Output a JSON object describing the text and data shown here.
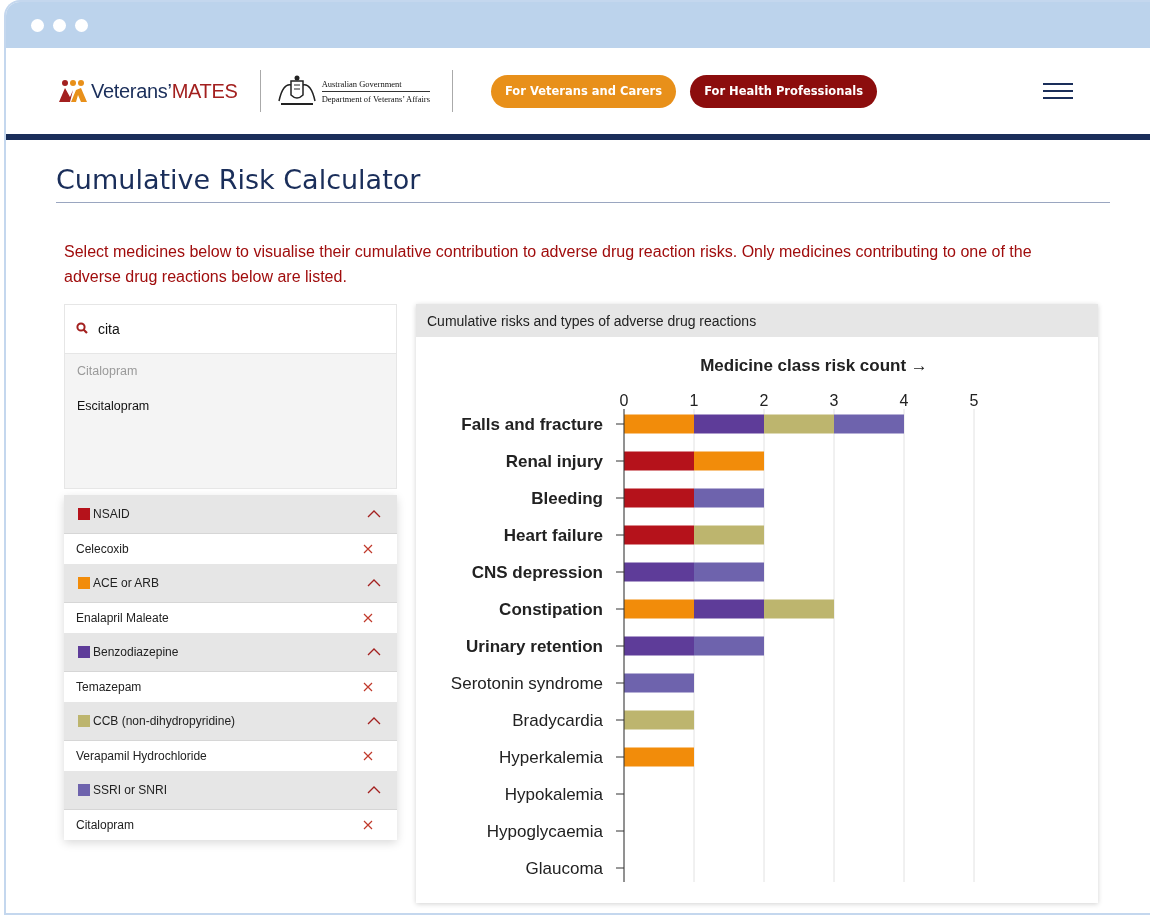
{
  "header": {
    "logo": {
      "text_1": "Veterans’",
      "text_2": "MATES"
    },
    "gov_logo": {
      "line_1": "Australian Government",
      "line_2": "Department of Veterans’ Affairs"
    },
    "nav_buttons": [
      {
        "label": "For Veterans and Carers",
        "color": "#e8901a"
      },
      {
        "label": "For Health Professionals",
        "color": "#8c0d0d"
      }
    ]
  },
  "page": {
    "title": "Cumulative Risk Calculator",
    "intro": "Select medicines below to visualise their cumulative contribution to adverse drug reaction risks. Only medicines contributing to one of the adverse drug reactions below are listed."
  },
  "search": {
    "value": "cita",
    "suggestions": [
      {
        "label": "Citalopram",
        "disabled": true
      },
      {
        "label": "Escitalopram",
        "disabled": false
      }
    ]
  },
  "groups": [
    {
      "name": "NSAID",
      "color": "#b5121b",
      "expanded": true,
      "medicines": [
        "Celecoxib"
      ]
    },
    {
      "name": "ACE or ARB",
      "color": "#f28c0a",
      "expanded": true,
      "medicines": [
        "Enalapril Maleate"
      ]
    },
    {
      "name": "Benzodiazepine",
      "color": "#5e3c99",
      "expanded": true,
      "medicines": [
        "Temazepam"
      ]
    },
    {
      "name": "CCB (non-dihydropyridine)",
      "color": "#bdb56e",
      "expanded": true,
      "medicines": [
        "Verapamil Hydrochloride"
      ]
    },
    {
      "name": "SSRI or SNRI",
      "color": "#6e63ad",
      "expanded": true,
      "medicines": [
        "Citalopram"
      ]
    }
  ],
  "chart_panel": {
    "title": "Cumulative risks and types of adverse drug reactions",
    "chart_data": {
      "type": "bar",
      "orientation": "horizontal",
      "stacked": true,
      "grid": true,
      "xlabel": "Medicine class risk count →",
      "xlim": [
        0,
        5
      ],
      "xticks": [
        0,
        1,
        2,
        3,
        4,
        5
      ],
      "categories": [
        "Falls and fracture",
        "Renal injury",
        "Bleeding",
        "Heart failure",
        "CNS depression",
        "Constipation",
        "Urinary retention",
        "Serotonin syndrome",
        "Bradycardia",
        "Hyperkalemia",
        "Hypokalemia",
        "Hypoglycaemia",
        "Glaucoma"
      ],
      "series": [
        {
          "color": "#b5121b",
          "values": [
            0,
            1,
            1,
            1,
            0,
            0,
            0,
            0,
            0,
            0,
            0,
            0,
            0
          ]
        },
        {
          "color": "#f28c0a",
          "values": [
            1,
            1,
            0,
            0,
            0,
            1,
            0,
            0,
            0,
            1,
            0,
            0,
            0
          ]
        },
        {
          "color": "#5e3c99",
          "values": [
            1,
            0,
            0,
            0,
            1,
            1,
            1,
            0,
            0,
            0,
            0,
            0,
            0
          ]
        },
        {
          "color": "#bdb56e",
          "values": [
            1,
            0,
            0,
            1,
            0,
            1,
            0,
            0,
            1,
            0,
            0,
            0,
            0
          ]
        },
        {
          "color": "#6e63ad",
          "values": [
            1,
            0,
            1,
            0,
            1,
            0,
            1,
            1,
            0,
            0,
            0,
            0,
            0
          ]
        }
      ]
    }
  }
}
